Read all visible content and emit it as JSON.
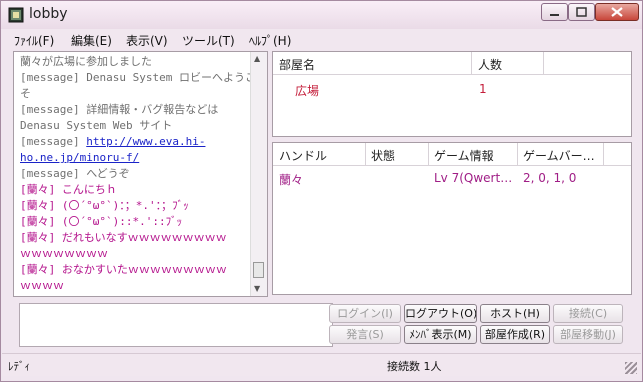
{
  "window": {
    "title": "lobby",
    "app_icon": "lobby-app-icon"
  },
  "menu": [
    "ﾌｧｲﾙ(F)",
    "編集(E)",
    "表示(V)",
    "ツール(T)",
    "ﾍﾙﾌﾟ(H)"
  ],
  "chat": {
    "lines": [
      {
        "text": "蘭々が広場に参加しました",
        "style": "sys"
      },
      {
        "text": "[message] Denasu System ロビーへようこ",
        "style": "sys"
      },
      {
        "text": "そ",
        "style": "sys"
      },
      {
        "text": "[message] 詳細情報・バグ報告などは",
        "style": "sys"
      },
      {
        "text": "Denasu System Web サイト",
        "style": "sys"
      },
      {
        "text": "[message] ",
        "style": "sys",
        "link": "http://www.eva.hi-"
      },
      {
        "text": "",
        "style": "sys",
        "link": "ho.ne.jp/minoru-f/"
      },
      {
        "text": "[message] へどうぞ",
        "style": "sys"
      },
      {
        "text": "[蘭々] こんにちｈ",
        "style": "pink"
      },
      {
        "text": "[蘭々] (〇´°ω°`)：；*.'：；ﾌﾞｯ",
        "style": "pink"
      },
      {
        "text": "[蘭々] (〇´°ω°`)::*.'::ﾌﾞｯ",
        "style": "pink"
      },
      {
        "text": "[蘭々] だれもいなすｗｗｗｗｗｗｗｗｗ",
        "style": "pink"
      },
      {
        "text": "ｗｗｗｗｗｗｗｗ",
        "style": "pink"
      },
      {
        "text": "[蘭々] おなかすいたｗｗｗｗｗｗｗｗｗ",
        "style": "pink"
      },
      {
        "text": "ｗｗｗｗ",
        "style": "pink"
      }
    ]
  },
  "rooms": {
    "headers": [
      "部屋名",
      "人数"
    ],
    "rows": [
      {
        "name": "広場",
        "count": "1"
      }
    ]
  },
  "users": {
    "headers": [
      "ハンドル",
      "状態",
      "ゲーム情報",
      "ゲームバー…"
    ],
    "rows": [
      {
        "handle": "蘭々",
        "status": "",
        "game_info": "Lv 7(Qwert…",
        "game_ver": "2, 0, 1, 0"
      }
    ]
  },
  "buttons": {
    "login": "ログイン(I)",
    "logout": "ログアウト(O)",
    "host": "ホスト(H)",
    "connect": "接続(C)",
    "speak": "発言(S)",
    "member_view": "ﾒﾝﾊﾞ表示(M)",
    "create_room": "部屋作成(R)",
    "move_room": "部屋移動(J)"
  },
  "status": {
    "left": "ﾚﾃﾞｨ",
    "connections": "接続数 1人"
  }
}
